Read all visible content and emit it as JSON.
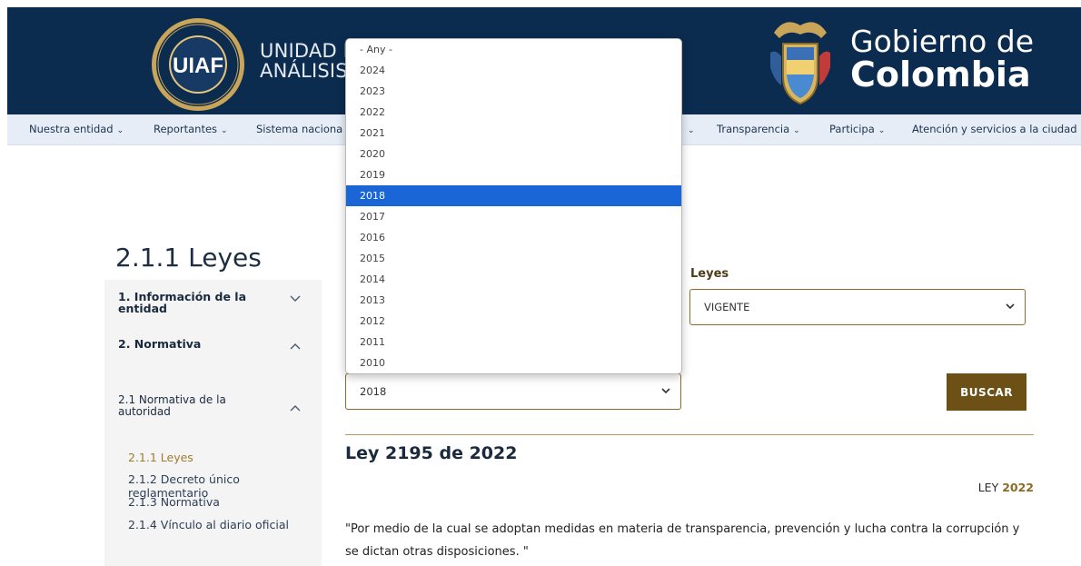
{
  "header": {
    "entity_line1": "UNIDAD DE",
    "entity_line2": "ANÁLISIS F",
    "seal_text": "UIAF",
    "gov_line1": "Gobierno de",
    "gov_line2": "Colombia"
  },
  "nav": {
    "items": [
      {
        "label": "Nuestra entidad"
      },
      {
        "label": "Reportantes"
      },
      {
        "label": "Sistema naciona"
      },
      {
        "label": ""
      },
      {
        "label": "Transparencia"
      },
      {
        "label": "Participa"
      },
      {
        "label": "Atención y servicios a la ciudad"
      }
    ]
  },
  "page": {
    "title": "2.1.1 Leyes"
  },
  "sidebar": {
    "items": [
      {
        "label": "1. Información de la entidad"
      },
      {
        "label": "2. Normativa"
      },
      {
        "label": "2.1 Normativa de la autoridad"
      }
    ],
    "subitems": [
      {
        "label": "2.1.1 Leyes"
      },
      {
        "label": "2.1.2 Decreto único reglamentario"
      },
      {
        "label": "2.1.3 Normativa"
      },
      {
        "label": "2.1.4 Vínculo al diario oficial"
      }
    ]
  },
  "filters": {
    "leyes_label": "Leyes",
    "leyes_value": "VIGENTE",
    "year_value": "2018",
    "search_button": "BUSCAR"
  },
  "dropdown": {
    "options": [
      "- Any -",
      "2024",
      "2023",
      "2022",
      "2021",
      "2020",
      "2019",
      "2018",
      "2017",
      "2016",
      "2015",
      "2014",
      "2013",
      "2012",
      "2011",
      "2010"
    ],
    "selected": "2018"
  },
  "result": {
    "title": "Ley 2195 de 2022",
    "type_label": "LEY",
    "type_year": "2022",
    "description": "\"Por medio de la cual se adoptan medidas en materia de transparencia, prevención y lucha contra la corrupción y se dictan otras disposiciones. \""
  },
  "colors": {
    "header_bg": "#0b2c4f",
    "nav_bg": "#e6edf6",
    "accent_gold": "#8d6b2a",
    "button_bg": "#6d5016",
    "selected_option": "#1a66d6"
  }
}
